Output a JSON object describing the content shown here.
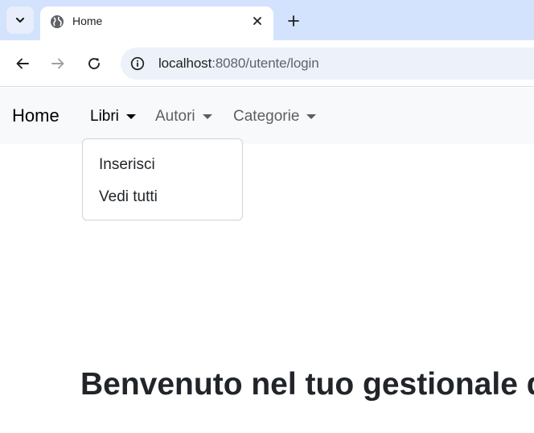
{
  "browser": {
    "tab": {
      "title": "Home",
      "favicon": "globe-icon"
    },
    "url": {
      "host": "localhost",
      "rest": ":8080/utente/login"
    },
    "icons": {
      "tab_search": "chevron-down-icon",
      "close": "close-icon",
      "new_tab": "plus-icon",
      "back": "arrow-left-icon",
      "forward": "arrow-right-icon",
      "reload": "reload-icon",
      "site_info": "info-icon"
    }
  },
  "navbar": {
    "brand": "Home",
    "items": [
      {
        "label": "Libri",
        "state": "open"
      },
      {
        "label": "Autori",
        "state": "closed"
      },
      {
        "label": "Categorie",
        "state": "closed"
      }
    ],
    "dropdown": {
      "items": [
        {
          "label": "Inserisci"
        },
        {
          "label": "Vedi tutti"
        }
      ]
    }
  },
  "main": {
    "heading": "Benvenuto nel tuo gestionale d"
  },
  "colors": {
    "tabstrip_bg": "#d3e3fd",
    "omnibox_bg": "#edf2fa",
    "navbar_bg": "#f8f9fa",
    "text_dark": "#212529",
    "nav_muted": "#5c5f62"
  }
}
